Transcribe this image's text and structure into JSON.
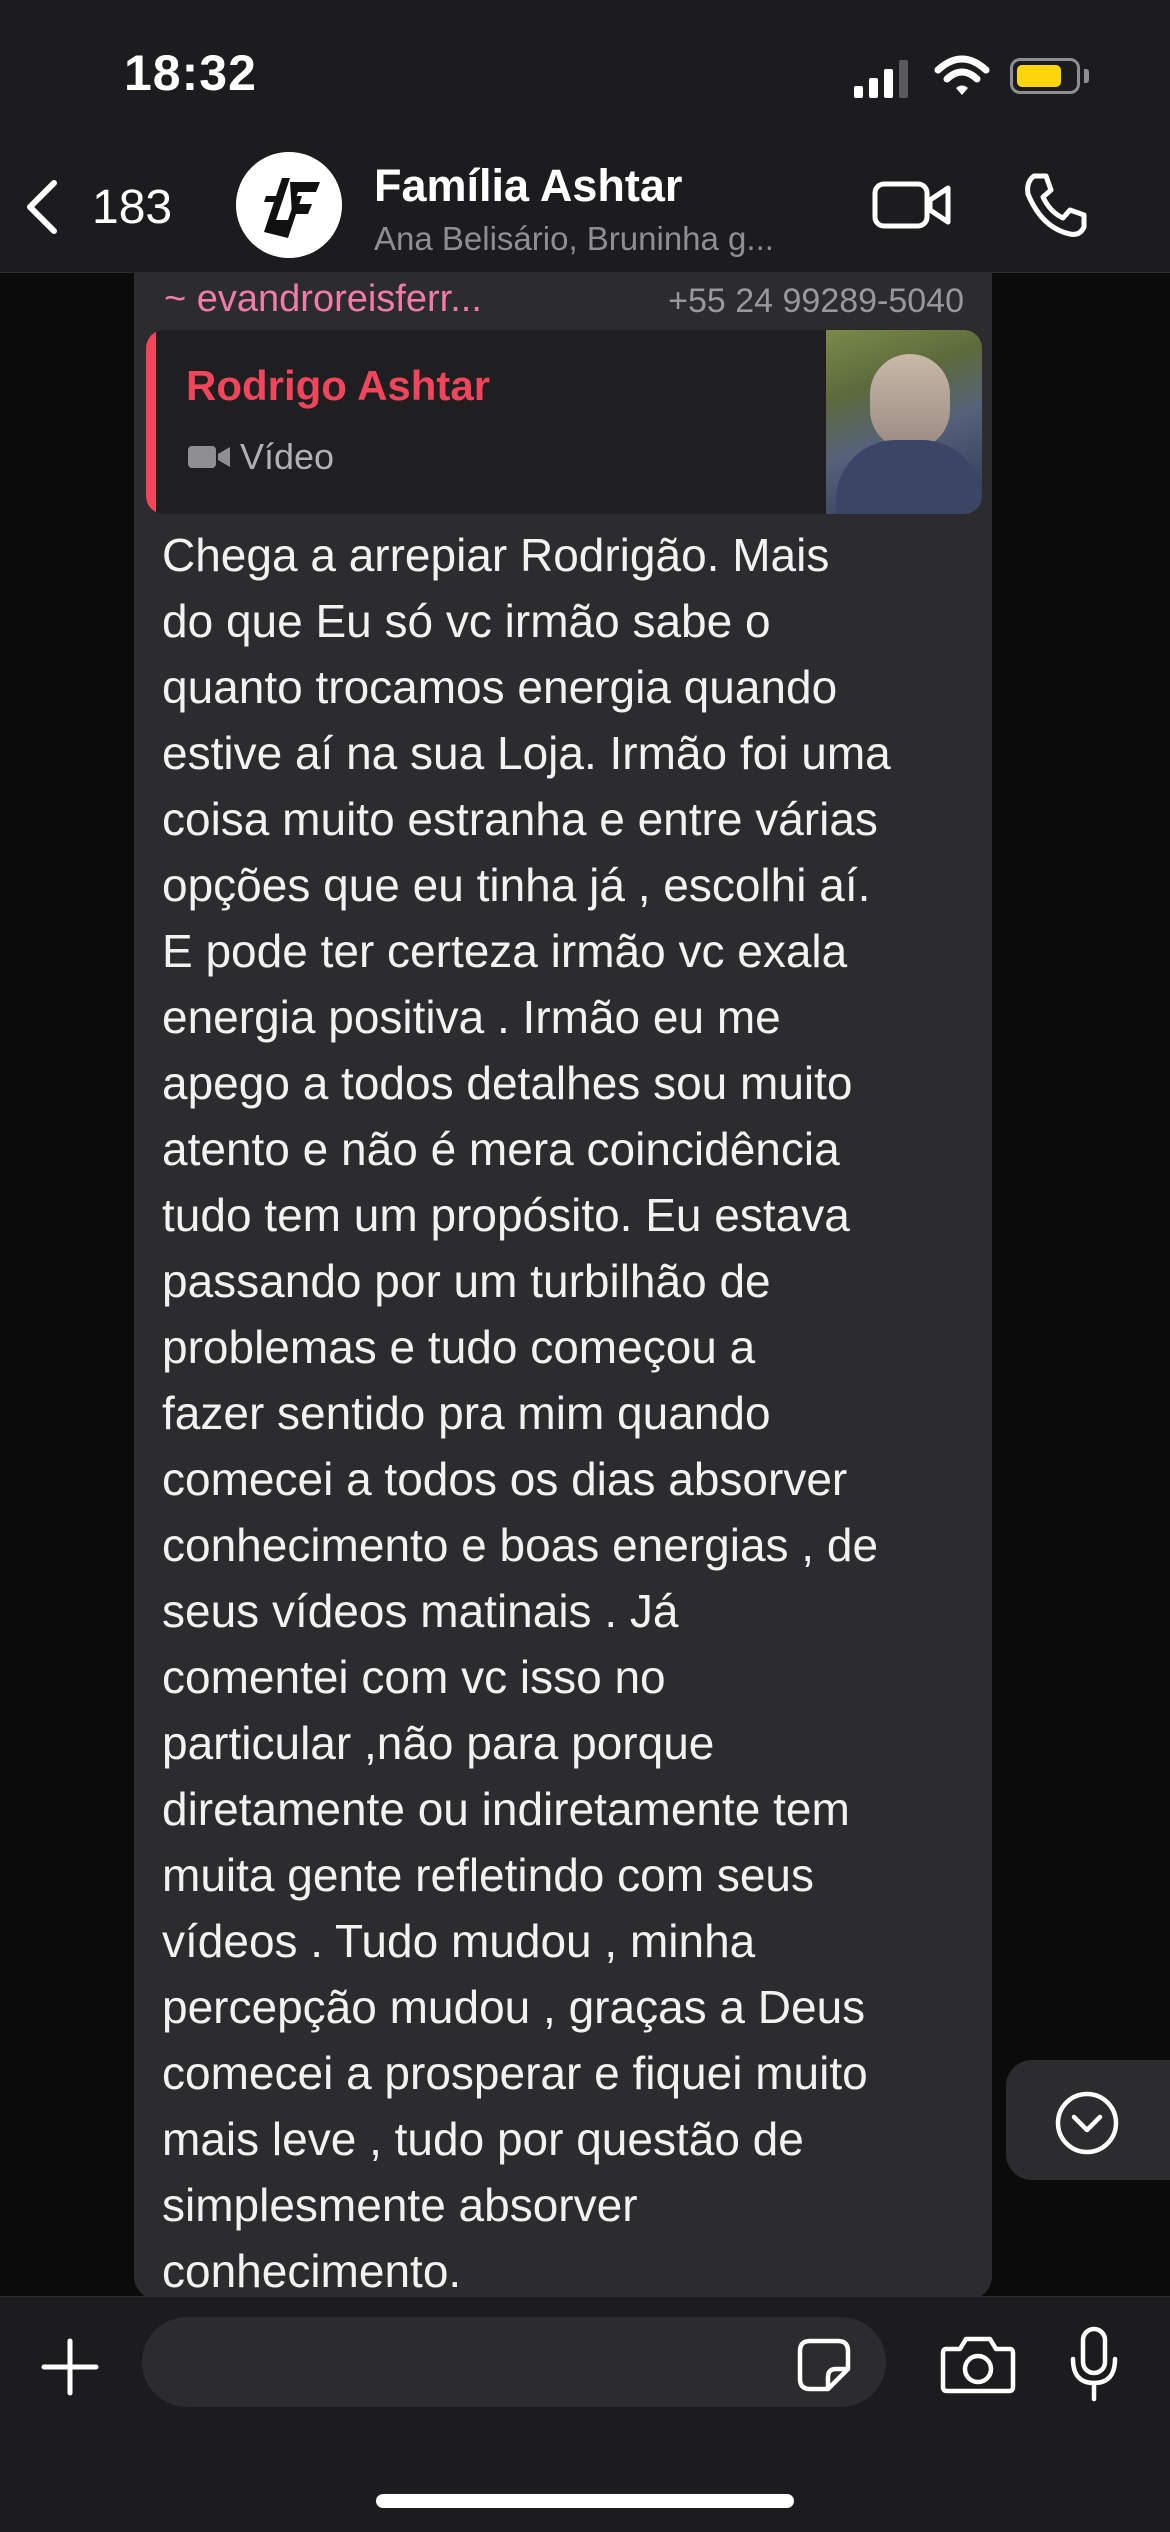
{
  "status_bar": {
    "time": "18:32",
    "battery_level": 0.75
  },
  "header": {
    "back_count": "183",
    "title": "Família Ashtar",
    "subtitle": "Ana Belisário, Bruninha g...",
    "avatar_text": "AF"
  },
  "message": {
    "sender_name": "~ evandroreisferr...",
    "sender_phone": "+55 24 99289-5040",
    "quote_author": "Rodrigo Ashtar",
    "quote_type": "Vídeo",
    "text": "Chega a arrepiar Rodrigão. Mais\ndo que Eu só vc irmão sabe o\nquanto trocamos energia quando\nestive aí na sua Loja. Irmão foi uma\ncoisa muito estranha e entre várias\nopções que eu tinha já , escolhi aí.\nE pode ter certeza irmão vc exala\nenergia positiva . Irmão eu me\napego a todos detalhes sou muito\natento e não é mera coincidência\ntudo tem um propósito. Eu estava\npassando por um turbilhão de\nproblemas  e tudo começou a\nfazer sentido pra mim quando\ncomecei a todos os dias absorver\nconhecimento e boas energias , de\nseus vídeos  matinais . Já\ncomentei com vc isso no\nparticular ,não para porque\ndiretamente ou indiretamente tem\nmuita gente refletindo com seus\nvídeos . Tudo mudou , minha\npercepção mudou , graças a Deus\ncomecei a prosperar e fiquei muito\nmais leve , tudo por questão de\nsimplesmente absorver\nconhecimento."
  },
  "composer": {
    "input_value": "",
    "input_placeholder": ""
  },
  "colors": {
    "sender_name": "#f27ba7",
    "quote_accent": "#f0455a",
    "battery": "#ffd60a",
    "bubble": "#2c2c2e"
  },
  "icons": [
    "back-chevron-icon",
    "video-call-icon",
    "phone-icon",
    "video-icon",
    "chevron-down-icon",
    "plus-icon",
    "sticker-icon",
    "camera-icon",
    "microphone-icon"
  ]
}
